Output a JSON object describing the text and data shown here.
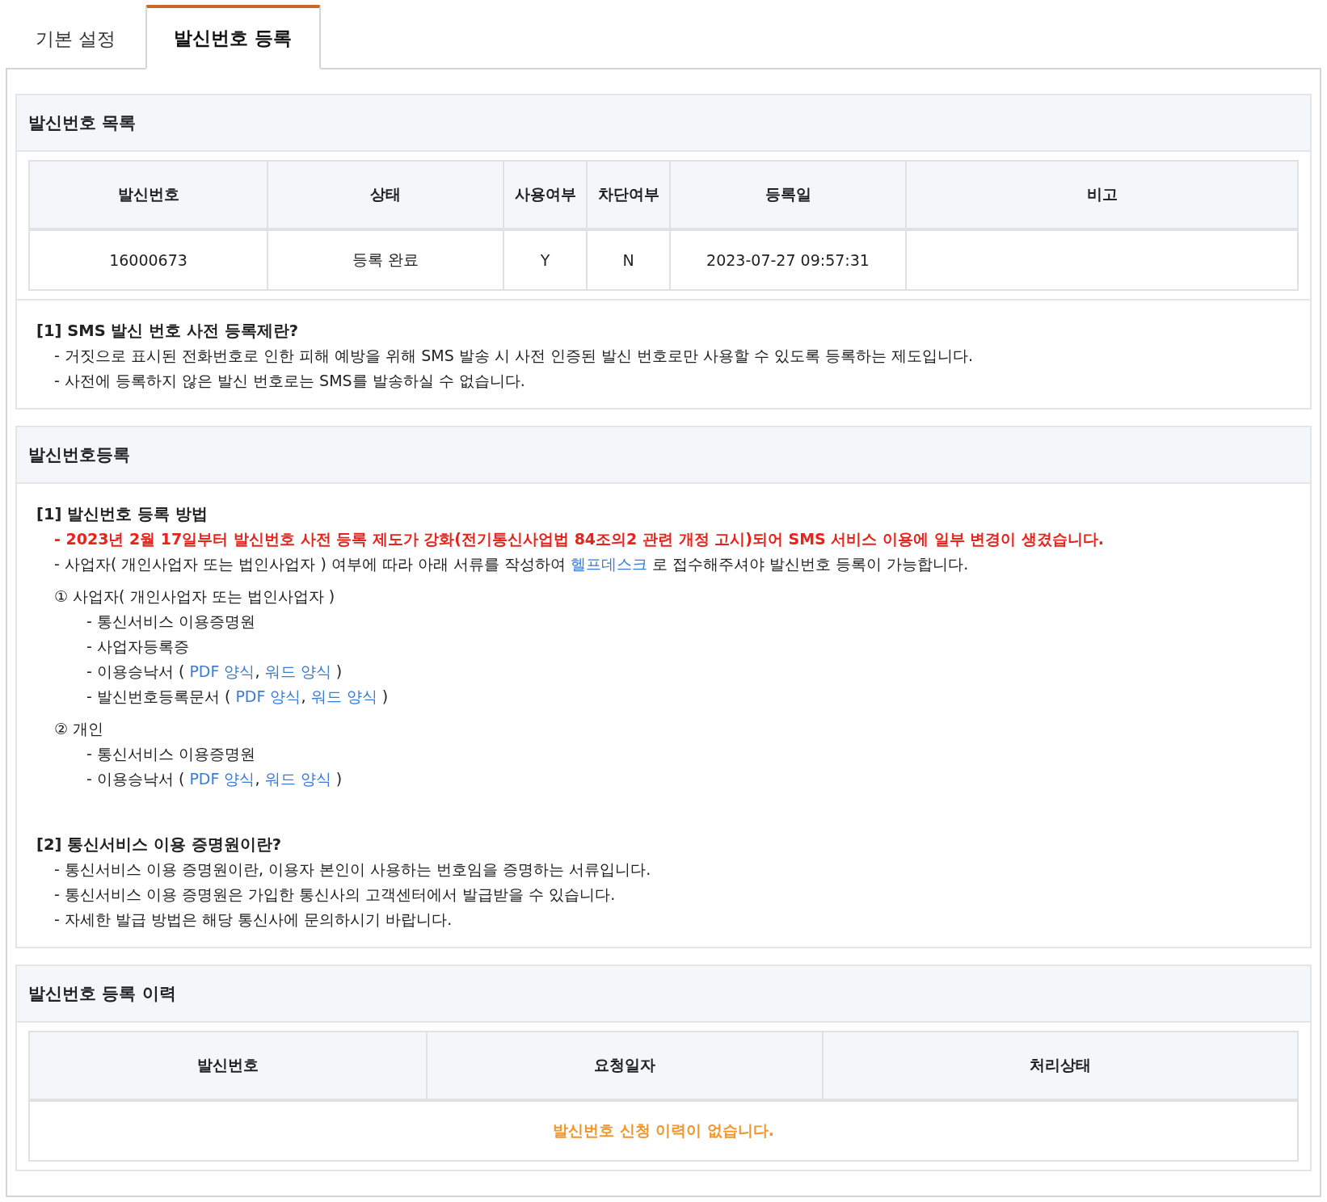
{
  "tabs": [
    {
      "label": "기본 설정",
      "selected": false
    },
    {
      "label": "발신번호 등록",
      "selected": true
    }
  ],
  "list_section": {
    "title": "발신번호 목록",
    "table": {
      "columns": [
        "발신번호",
        "상태",
        "사용여부",
        "차단여부",
        "등록일",
        "비고"
      ],
      "rows": [
        [
          "16000673",
          "등록 완료",
          "Y",
          "N",
          "2023-07-27 09:57:31",
          ""
        ]
      ]
    },
    "info": {
      "heading": "[1] SMS 발신 번호 사전 등록제란?",
      "lines": [
        "- 거짓으로 표시된 전화번호로 인한 피해 예방을 위해 SMS 발송 시 사전 인증된 발신 번호로만 사용할 수 있도록 등록하는 제도입니다.",
        "- 사전에 등록하지 않은 발신 번호로는 SMS를 발송하실 수 없습니다."
      ]
    }
  },
  "register_section": {
    "title": "발신번호등록",
    "method": {
      "heading": "[1] 발신번호 등록 방법",
      "lines": [
        {
          "kind": "alert",
          "segments": [
            {
              "text": "- 2023년 2월 17일부터 발신번호 사전 등록 제도가 강화(전기통신사업법 84조의2 관련 개정 고시)되어 SMS 서비스 이용에 일부 변경이 생겼습니다.",
              "link": false
            }
          ]
        },
        {
          "kind": "plain",
          "segments": [
            {
              "text": "- 사업자( 개인사업자 또는 법인사업자 ) 여부에 따라 아래 서류를 작성하여 ",
              "link": false
            },
            {
              "text": "헬프데스크",
              "link": true
            },
            {
              "text": " 로 접수해주셔야 발신번호 등록이 가능합니다.",
              "link": false
            }
          ]
        }
      ],
      "groups": [
        {
          "title": "① 사업자( 개인사업자 또는 법인사업자 )",
          "children": [
            {
              "segments": [
                {
                  "text": "- 통신서비스 이용증명원",
                  "link": false
                }
              ]
            },
            {
              "segments": [
                {
                  "text": "- 사업자등록증",
                  "link": false
                }
              ]
            },
            {
              "segments": [
                {
                  "text": "- 이용승낙서 ( ",
                  "link": false
                },
                {
                  "text": "PDF 양식",
                  "link": true
                },
                {
                  "text": ", ",
                  "link": false
                },
                {
                  "text": "워드 양식",
                  "link": true
                },
                {
                  "text": " )",
                  "link": false
                }
              ]
            },
            {
              "segments": [
                {
                  "text": "- 발신번호등록문서 ( ",
                  "link": false
                },
                {
                  "text": "PDF 양식",
                  "link": true
                },
                {
                  "text": ", ",
                  "link": false
                },
                {
                  "text": "워드 양식",
                  "link": true
                },
                {
                  "text": " )",
                  "link": false
                }
              ]
            }
          ]
        },
        {
          "title": "② 개인",
          "children": [
            {
              "segments": [
                {
                  "text": "- 통신서비스 이용증명원",
                  "link": false
                }
              ]
            },
            {
              "segments": [
                {
                  "text": "- 이용승낙서 ( ",
                  "link": false
                },
                {
                  "text": "PDF 양식",
                  "link": true
                },
                {
                  "text": ", ",
                  "link": false
                },
                {
                  "text": "워드 양식",
                  "link": true
                },
                {
                  "text": " )",
                  "link": false
                }
              ]
            }
          ]
        }
      ]
    },
    "certificate": {
      "heading": "[2] 통신서비스 이용 증명원이란?",
      "lines": [
        "- 통신서비스 이용 증명원이란, 이용자 본인이 사용하는 번호임을 증명하는 서류입니다.",
        "- 통신서비스 이용 증명원은 가입한 통신사의 고객센터에서 발급받을 수 있습니다.",
        "- 자세한 발급 방법은 해당 통신사에 문의하시기 바랍니다."
      ]
    }
  },
  "history_section": {
    "title": "발신번호 등록 이력",
    "table": {
      "columns": [
        "발신번호",
        "요청일자",
        "처리상태"
      ],
      "empty_message": "발신번호 신청 이력이 없습니다."
    }
  }
}
